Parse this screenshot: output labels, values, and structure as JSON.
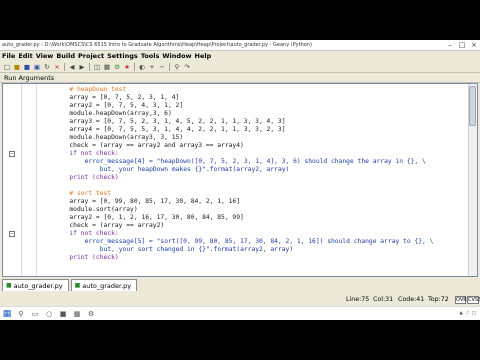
{
  "window": {
    "title": "auto_grader.py - D:\\Work\\OMSCS\\CS 6515 Intro to Graduate Algorithms\\Heap\\Heap\\Project\\auto_grader.py - Geany (Python)",
    "minimize_icon": "minimize-icon",
    "maximize_icon": "maximize-icon",
    "close_icon": "close-icon"
  },
  "menu": [
    "File",
    "Edit",
    "View",
    "Build",
    "Project",
    "Settings",
    "Tools",
    "Window",
    "Help"
  ],
  "run_arguments_label": "Run Arguments",
  "code_lines": [
    {
      "text": "# heapDown test",
      "kind": "comment",
      "indent": 8
    },
    {
      "text": "array = [0, 7, 5, 2, 3, 1, 4]",
      "kind": "code",
      "indent": 8
    },
    {
      "text": "array2 = [0, 7, 5, 4, 3, 1, 2]",
      "kind": "code",
      "indent": 8
    },
    {
      "text": "module.heapDown(array,3, 6)",
      "kind": "code",
      "indent": 8
    },
    {
      "text": "array3 = [0, 7, 5, 2, 3, 1, 4, 5, 2, 2, 1, 1, 3, 3, 4, 3]",
      "kind": "code",
      "indent": 8
    },
    {
      "text": "array4 = [0, 7, 5, 5, 3, 1, 4, 4, 2, 2, 1, 1, 3, 3, 2, 3]",
      "kind": "code",
      "indent": 8
    },
    {
      "text": "module.heapDown(array3, 3, 15)",
      "kind": "code",
      "indent": 8
    },
    {
      "text": "check = (array == array2 and array3 == array4)",
      "kind": "code",
      "indent": 8
    },
    {
      "text": "if not check:",
      "kind": "if",
      "indent": 8,
      "fold": true
    },
    {
      "text": "error_message[4] = \"heapDown([0, 7, 5, 2, 3, 1, 4], 3, 6) should change the array in {}, \\",
      "kind": "string-line",
      "indent": 12
    },
    {
      "text": "but, your heapDown makes {}\".format(array2, array)",
      "kind": "string-cont",
      "indent": 16
    },
    {
      "text": "print (check)",
      "kind": "print",
      "indent": 8
    },
    {
      "text": "",
      "kind": "blank",
      "indent": 0
    },
    {
      "text": "# sort test",
      "kind": "comment",
      "indent": 8
    },
    {
      "text": "array = [0, 99, 80, 85, 17, 30, 84, 2, 1, 16]",
      "kind": "code",
      "indent": 8
    },
    {
      "text": "module.sort(array)",
      "kind": "code",
      "indent": 8
    },
    {
      "text": "array2 = [0, 1, 2, 16, 17, 30, 80, 84, 85, 99]",
      "kind": "code",
      "indent": 8
    },
    {
      "text": "check = (array == array2)",
      "kind": "code",
      "indent": 8
    },
    {
      "text": "if not check:",
      "kind": "if",
      "indent": 8,
      "fold": true
    },
    {
      "text": "error_message[5] = \"sort([0, 99, 80, 85, 17, 30, 84, 2, 1, 16]) should change array to {}, \\",
      "kind": "string-line",
      "indent": 12
    },
    {
      "text": "but, your sort changed in {}\".format(array2, array)",
      "kind": "string-cont",
      "indent": 16
    },
    {
      "text": "print (check)",
      "kind": "print",
      "indent": 8
    }
  ],
  "tabs": [
    {
      "label": "auto_grader.py",
      "icon": "python-file-icon"
    },
    {
      "label": "auto_grader.py",
      "icon": "python-file-icon"
    }
  ],
  "status": {
    "line": "Line:75",
    "col": "Col:31",
    "code": "Code:41",
    "top": "Top:72",
    "mode": "OVR",
    "encoding": "CVSS"
  },
  "colors": {
    "comment": "#e87722",
    "keyword": "#7a2aa6",
    "string": "#1c3ea8",
    "editor_bg": "#ffffff",
    "chrome_bg": "#ece9d8"
  }
}
